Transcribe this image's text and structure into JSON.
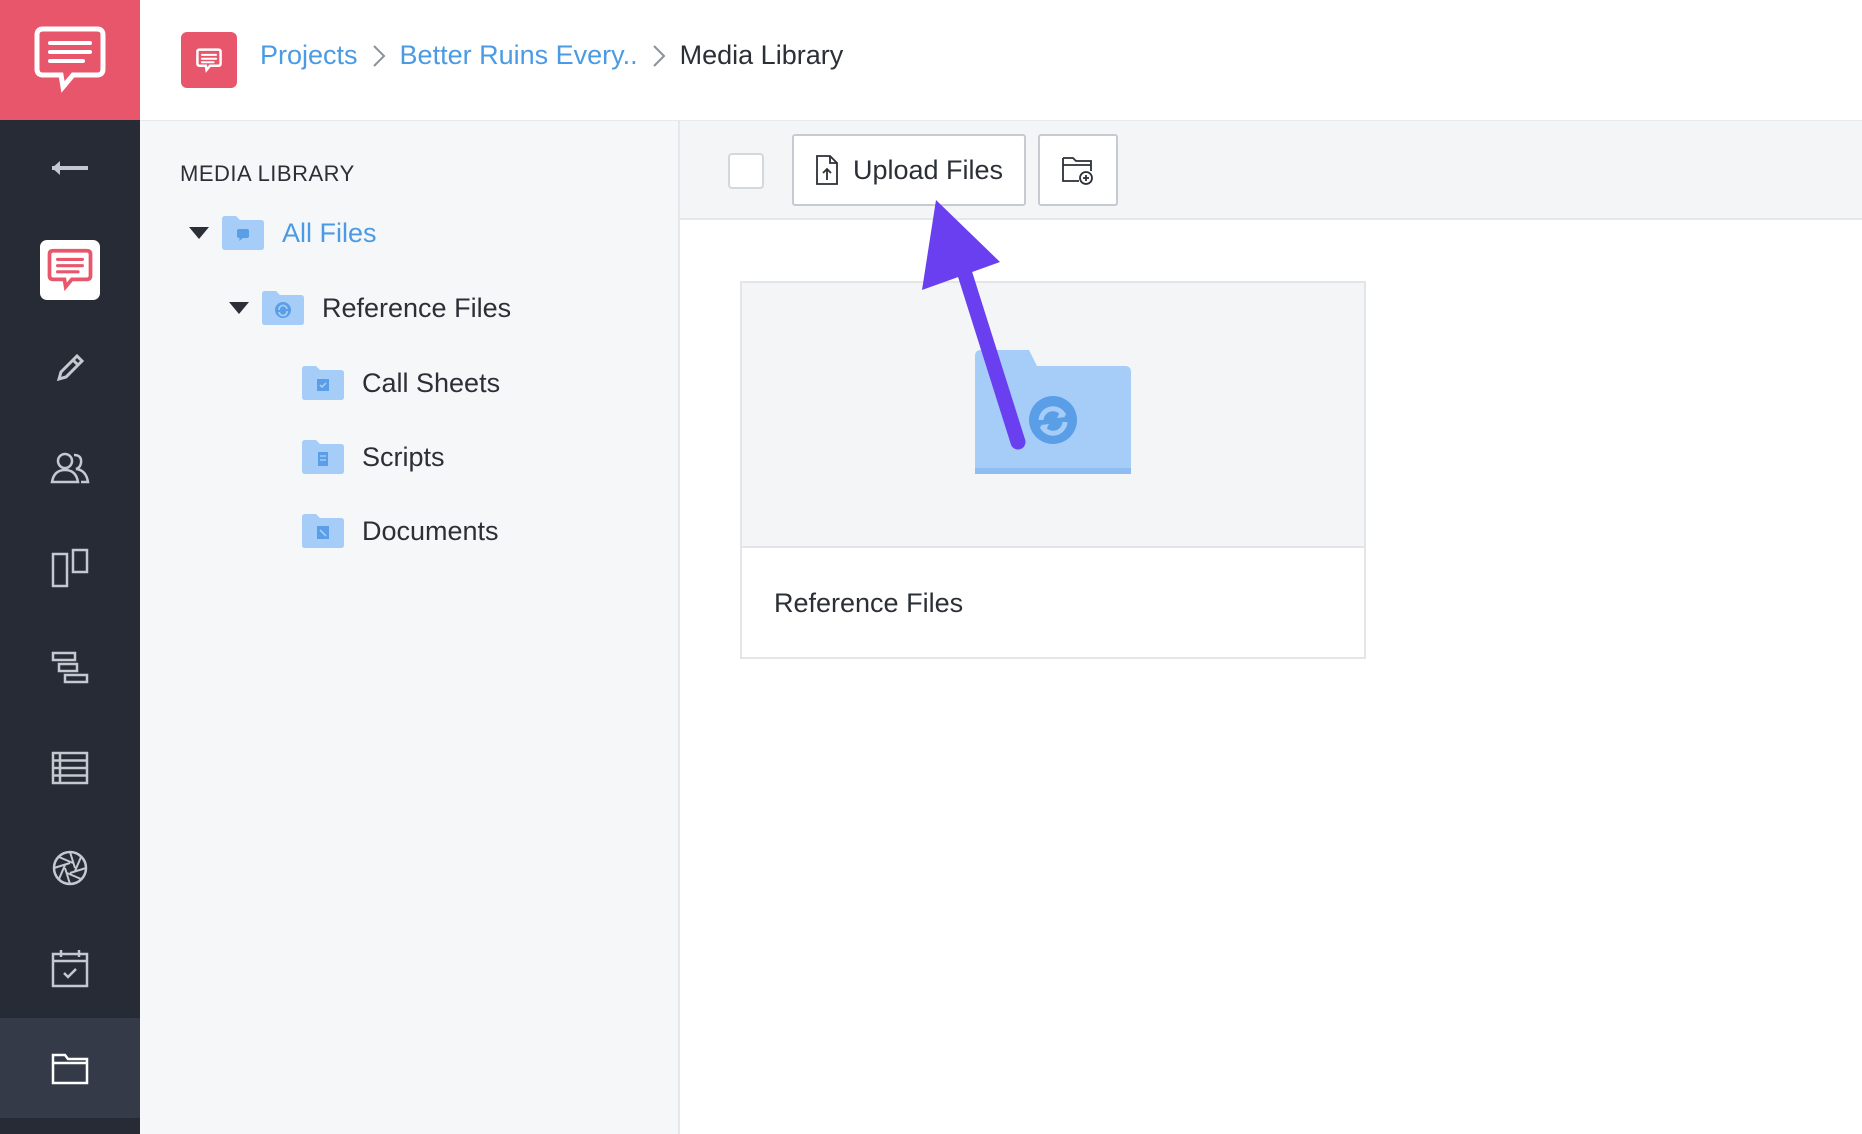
{
  "breadcrumb": {
    "projects": "Projects",
    "project": "Better Ruins Every..",
    "current": "Media Library"
  },
  "tree": {
    "title": "MEDIA LIBRARY",
    "items": [
      {
        "label": "All Files",
        "icon": "folder-chat-icon",
        "selected": true
      },
      {
        "label": "Reference Files",
        "icon": "folder-sync-icon"
      },
      {
        "label": "Call Sheets",
        "icon": "folder-check-icon"
      },
      {
        "label": "Scripts",
        "icon": "folder-script-icon"
      },
      {
        "label": "Documents",
        "icon": "folder-document-icon"
      }
    ]
  },
  "toolbar": {
    "upload_label": "Upload Files",
    "new_folder_icon": "folder-plus-icon"
  },
  "content": {
    "cards": [
      {
        "name": "Reference Files",
        "icon": "folder-sync-icon"
      }
    ]
  },
  "colors": {
    "brand": "#e8566c",
    "rail": "#262b35",
    "link": "#4a9be3",
    "folder": "#a5cdf8",
    "annotation_arrow": "#6a3ff0"
  }
}
